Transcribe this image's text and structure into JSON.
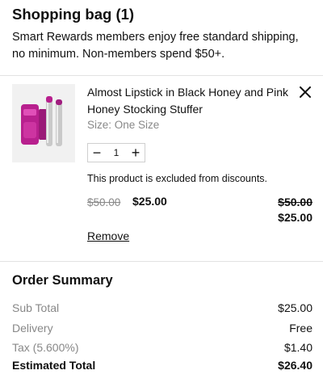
{
  "header": {
    "title": "Shopping bag (1)",
    "promo": "Smart Rewards members enjoy free standard shipping, no minimum. Non-members spend $50+."
  },
  "item": {
    "name": "Almost Lipstick in Black Honey and Pink Honey Stocking Stuffer",
    "size": "Size: One Size",
    "quantity": "1",
    "decrement": "−",
    "increment": "+",
    "close_icon": "close-icon",
    "excluded_note": "This product is excluded from discounts.",
    "original_price": "$50.00",
    "sale_price": "$25.00",
    "line_total_original": "$50.00",
    "line_total": "$25.00",
    "remove_label": "Remove",
    "image": "lipstick-duo-product-image",
    "colors": {
      "product_pink": "#b8208e",
      "cap_silver": "#c9c9c9"
    }
  },
  "summary": {
    "title": "Order Summary",
    "rows": [
      {
        "label": "Sub Total",
        "value": "$25.00"
      },
      {
        "label": "Delivery",
        "value": "Free"
      },
      {
        "label": "Tax (5.600%)",
        "value": "$1.40"
      },
      {
        "label": "Estimated Total",
        "value": "$26.40"
      }
    ]
  }
}
